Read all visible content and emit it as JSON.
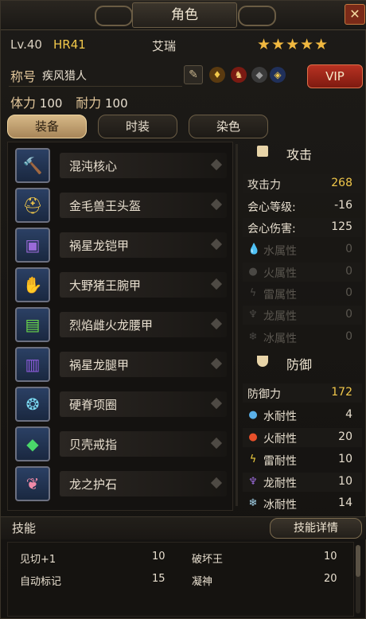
{
  "window": {
    "title": "角色",
    "close_icon": "close-x-icon"
  },
  "player": {
    "level": "Lv.40",
    "hr": "HR41",
    "name": "艾瑞",
    "stars": "★★★★★",
    "title_label": "称号",
    "title_value": "疾风猎人",
    "stamina_label": "体力",
    "stamina_value": "100",
    "endurance_label": "耐力",
    "endurance_value": "100"
  },
  "vip_label": "VIP",
  "tabs": [
    {
      "label": "装备",
      "active": true
    },
    {
      "label": "时装",
      "active": false
    },
    {
      "label": "染色",
      "active": false
    }
  ],
  "equipment": [
    {
      "name": "混沌核心",
      "icon": "hammer-weapon-icon"
    },
    {
      "name": "金毛兽王头盔",
      "icon": "helmet-icon"
    },
    {
      "name": "祸星龙铠甲",
      "icon": "chest-armor-icon"
    },
    {
      "name": "大野猪王腕甲",
      "icon": "gauntlet-icon"
    },
    {
      "name": "烈焰雌火龙腰甲",
      "icon": "waist-armor-icon"
    },
    {
      "name": "祸星龙腿甲",
      "icon": "leg-armor-icon"
    },
    {
      "name": "硬脊项圈",
      "icon": "necklace-icon"
    },
    {
      "name": "贝壳戒指",
      "icon": "ring-gem-icon"
    },
    {
      "name": "龙之护石",
      "icon": "talisman-icon"
    }
  ],
  "attack": {
    "title": "攻击",
    "rows": [
      {
        "label": "攻击力",
        "value": "268"
      },
      {
        "label": "会心等级:",
        "value": "-16"
      },
      {
        "label": "会心伤害:",
        "value": "125"
      },
      {
        "label": "水属性",
        "value": "0"
      },
      {
        "label": "火属性",
        "value": "0"
      },
      {
        "label": "雷属性",
        "value": "0"
      },
      {
        "label": "龙属性",
        "value": "0"
      },
      {
        "label": "冰属性",
        "value": "0"
      }
    ]
  },
  "defense": {
    "title": "防御",
    "rows": [
      {
        "label": "防御力",
        "value": "172"
      },
      {
        "label": "水耐性",
        "value": "4"
      },
      {
        "label": "火耐性",
        "value": "20"
      },
      {
        "label": "雷耐性",
        "value": "10"
      },
      {
        "label": "龙耐性",
        "value": "10"
      },
      {
        "label": "冰耐性",
        "value": "14"
      }
    ]
  },
  "skills": {
    "title": "技能",
    "detail_button": "技能详情",
    "items": [
      {
        "name": "见切+1",
        "value": "10"
      },
      {
        "name": "破坏王",
        "value": "10"
      },
      {
        "name": "自动标记",
        "value": "15"
      },
      {
        "name": "凝神",
        "value": "20"
      }
    ]
  },
  "colors": {
    "gold": "#f2c84a",
    "vip_red": "#b83222",
    "tab_active": "#d6b887"
  }
}
